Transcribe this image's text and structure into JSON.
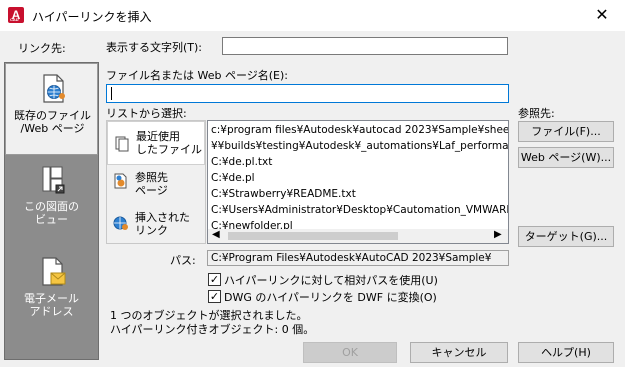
{
  "window": {
    "title": "ハイパーリンクを挿入",
    "close_glyph": "✕",
    "app_icon_letter": "A",
    "app_icon_sub": "CAD"
  },
  "link_to": {
    "label": "リンク先:"
  },
  "sidebar": {
    "items": [
      {
        "label_1": "既存のファイル",
        "label_2": "/Web ページ",
        "icon": "globe-file-icon"
      },
      {
        "label_1": "この図面の",
        "label_2": "ビュー",
        "icon": "drawing-view-icon"
      },
      {
        "label_1": "電子メール",
        "label_2": "アドレス",
        "icon": "email-icon"
      }
    ]
  },
  "display_text": {
    "label": "表示する文字列(T):",
    "value": ""
  },
  "filename": {
    "label": "ファイル名または Web ページ名(E):",
    "value": ""
  },
  "select_from": {
    "label": "リストから選択:"
  },
  "tabs": [
    {
      "label_1": "最近使用",
      "label_2": "したファイル",
      "icon": "recent-files-icon"
    },
    {
      "label_1": "参照先",
      "label_2": "ページ",
      "icon": "browsed-pages-icon"
    },
    {
      "label_1": "挿入された",
      "label_2": "リンク",
      "icon": "inserted-links-icon"
    }
  ],
  "file_list": [
    "c:¥program files¥Autodesk¥autocad 2023¥Sample¥sheetsets",
    "¥¥builds¥testing¥Autodesk¥_automations¥Laf_performance",
    "C:¥de.pl.txt",
    "C:¥de.pl",
    "C:¥Strawberry¥README.txt",
    "C:¥Users¥Administrator¥Desktop¥Cautomation_VMWARE",
    "C:¥newfolder.pl"
  ],
  "browse": {
    "label": "参照先:",
    "file_button": "ファイル(F)...",
    "web_button": "Web ページ(W)...",
    "target_button": "ターゲット(G)..."
  },
  "path": {
    "label": "パス:",
    "value": "C:¥Program Files¥Autodesk¥AutoCAD 2023¥Sample¥"
  },
  "options": {
    "relative_path": {
      "label": "ハイパーリンクに対して相対パスを使用(U)",
      "checked": true
    },
    "dwg_to_dwf": {
      "label": "DWG のハイパーリンクを DWF に変換(O)",
      "checked": true
    }
  },
  "status": {
    "line1": "1 つのオブジェクトが選択されました。",
    "line2": "ハイパーリンク付きオブジェクト: 0 個。"
  },
  "footer": {
    "ok": "OK",
    "cancel": "キャンセル",
    "help": "ヘルプ(H)"
  },
  "colors": {
    "accent": "#0078d7",
    "sidebar_bg": "#8c8c8c",
    "app_icon": "#c8102e"
  }
}
